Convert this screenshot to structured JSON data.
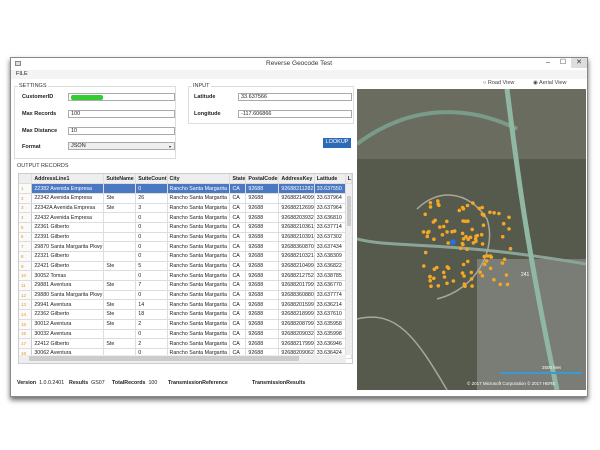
{
  "window": {
    "title": "Reverse Geocode Test",
    "minimize": "–",
    "maximize": "☐",
    "close": "✕"
  },
  "menu": {
    "file": "FILE"
  },
  "settings": {
    "label": "SETTINGS",
    "customer_id_label": "CustomerID",
    "max_records_label": "Max Records",
    "max_records": "100",
    "max_distance_label": "Max Distance",
    "max_distance": "10",
    "format_label": "Format",
    "format": "JSON"
  },
  "input": {
    "label": "INPUT",
    "latitude_label": "Latitude",
    "latitude": "33.637566",
    "longitude_label": "Longitude",
    "longitude": "-117.606866",
    "lookup": "LOOKUP"
  },
  "output": {
    "label": "OUTPUT RECORDS",
    "columns": [
      "AddressLine1",
      "SuiteName",
      "SuiteCount",
      "City",
      "State",
      "PostalCode",
      "AddressKey",
      "Latitude",
      "L"
    ],
    "rows": [
      [
        "22382 Avenida Empresa",
        "",
        "0",
        "Rancho Santa Margarita",
        "CA",
        "92688",
        "92688211282",
        "33.637550",
        "-"
      ],
      [
        "22342 Avenida Empresa",
        "Ste",
        "26",
        "Rancho Santa Margarita",
        "CA",
        "92688",
        "92688214099",
        "33.637964",
        "-"
      ],
      [
        "22342A Avenida Empresa",
        "Ste",
        "3",
        "Rancho Santa Margarita",
        "CA",
        "92688",
        "92688212699",
        "33.637964",
        "-"
      ],
      [
        "22432 Avenida Empresa",
        "",
        "0",
        "Rancho Santa Margarita",
        "CA",
        "92688",
        "92688203932",
        "33.636810",
        "-"
      ],
      [
        "22361 Gilberto",
        "",
        "0",
        "Rancho Santa Margarita",
        "CA",
        "92688",
        "92688210361",
        "33.637714",
        "-"
      ],
      [
        "22391 Gilberto",
        "",
        "0",
        "Rancho Santa Margarita",
        "CA",
        "92688",
        "92688210391",
        "33.637302",
        "-"
      ],
      [
        "29870 Santa Margarita Pkwy",
        "",
        "0",
        "Rancho Santa Margarita",
        "CA",
        "92688",
        "92688360870",
        "33.637434",
        "-"
      ],
      [
        "22321 Gilberto",
        "",
        "0",
        "Rancho Santa Margarita",
        "CA",
        "92688",
        "92688210321",
        "33.638309",
        "-"
      ],
      [
        "22421 Gilberto",
        "Ste",
        "5",
        "Rancho Santa Margarita",
        "CA",
        "92688",
        "92688210499",
        "33.636822",
        "-"
      ],
      [
        "30052 Tomas",
        "",
        "0",
        "Rancho Santa Margarita",
        "CA",
        "92688",
        "92688212752",
        "33.638785",
        "-"
      ],
      [
        "29881 Aventura",
        "Ste",
        "7",
        "Rancho Santa Margarita",
        "CA",
        "92688",
        "92688201799",
        "33.636770",
        "-"
      ],
      [
        "29880 Santa Margarita Pkwy",
        "",
        "0",
        "Rancho Santa Margarita",
        "CA",
        "92688",
        "92688360880",
        "33.637774",
        "-"
      ],
      [
        "29941 Aventura",
        "Ste",
        "14",
        "Rancho Santa Margarita",
        "CA",
        "92688",
        "92688201599",
        "33.636214",
        "-"
      ],
      [
        "22362 Gilberto",
        "Ste",
        "18",
        "Rancho Santa Margarita",
        "CA",
        "92688",
        "92688218999",
        "33.637610",
        "-"
      ],
      [
        "30012 Aventura",
        "Ste",
        "2",
        "Rancho Santa Margarita",
        "CA",
        "92688",
        "92688208799",
        "33.635958",
        "-"
      ],
      [
        "30032 Aventura",
        "",
        "0",
        "Rancho Santa Margarita",
        "CA",
        "92688",
        "92688209032",
        "33.635998",
        "-"
      ],
      [
        "22412 Gilberto",
        "Ste",
        "2",
        "Rancho Santa Margarita",
        "CA",
        "92688",
        "92688217999",
        "33.636946",
        "-"
      ],
      [
        "30062 Aventura",
        "",
        "0",
        "Rancho Santa Margarita",
        "CA",
        "92688",
        "92688209062",
        "33.636424",
        "-"
      ]
    ]
  },
  "status": {
    "version_label": "Version",
    "version": "1.0.0.2401",
    "results_label": "Results",
    "results": "GS07",
    "total_label": "TotalRecords",
    "total": "100",
    "transref_label": "TransmissionReference",
    "transres_label": "TransmissionResults"
  },
  "map": {
    "road_view": "Road View",
    "aerial_view": "Aerial View",
    "selected_view": "Aerial View",
    "scale": "2500 feet",
    "copyright": "© 2017 Microsoft Corporation  © 2017 HERE",
    "road_label": "241",
    "pin_color": "#f5a623",
    "center_color": "#2a6fe0"
  }
}
